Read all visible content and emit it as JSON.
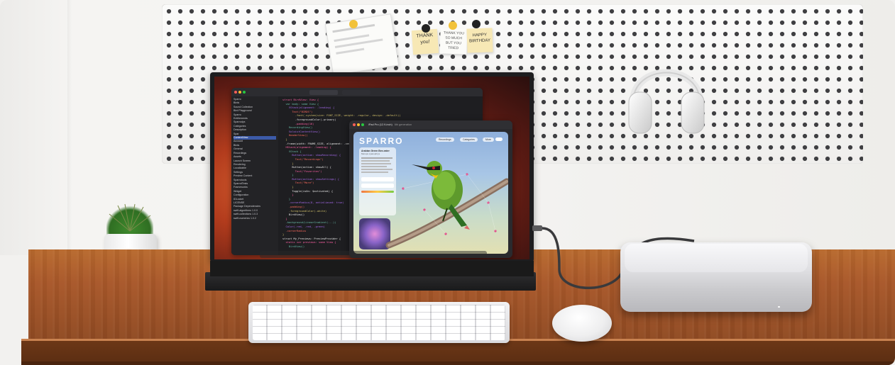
{
  "scene": {
    "description_hidden": true
  },
  "notes": {
    "note1": "THANK you!",
    "note2": "THANK YOU SO MUCH BUT YOU TRIED",
    "note3": "HAPPY BIRTHDAY"
  },
  "monitor": {
    "sidebar_items": [
      "Sparro",
      "Birds",
      "Sound Collection",
      "Bird Playground",
      "Sparro",
      "Entitlements",
      "Sparrodys",
      "Categories",
      "Description",
      "Spar",
      "ContentView",
      "Account",
      "Birds",
      "General",
      "Recordings",
      "Assets",
      "Launch Screen",
      "Rendering",
      "Localizable",
      "Settings",
      "Preview Content",
      "Sparrotools",
      "SparrotTests",
      "Frameworks",
      "Widget",
      "Configuration",
      "IDLocket",
      "LICENSE",
      "Package Dependencies",
      "swift-algorithms 1.0.0",
      "swift-collections 1.0.3",
      "swift-numerics 1.0.2"
    ],
    "code_lines": [
      "struct BirdView: View {",
      "  var body: some View {",
      "    VStack(alignment: .leading) {",
      "      Text(\"BIRDS\")",
      "        .font(.system(size: FONT_SIZE, weight: .regular, design: .default))",
      "        .foregroundColor(.primary)",
      "        .padding(16)",
      "    RecordingView()",
      "    SoloistContentView()",
      "    HeaderView()",
      "  }",
      "  .frame(width: FRAME_SIZE, alignment: .center)",
      "  HStack(alignment: .leading) {",
      "    VStack {",
      "      Button(action: showRecording) {",
      "        Text(\"Recordings\")",
      "      }",
      "      Button(action: showAll) {",
      "        Text(\"Favorites\")",
      "      }",
      "      Button(action: showSettings) {",
      "        Text(\"More\")",
      "      }",
      "      Toggle(isOn: $activated) {",
      "      }",
      "    }",
      "    .cornerRadius(8, antialiased: true)",
      "    .padding()",
      "    .foregroundColor(.white)",
      "    BirdView()",
      "  }",
      "  .background(LinearGradient(...))",
      "  Color(.red, .red, .green)",
      "  .cornerRadius",
      "}",
      "struct My_Previews: PreviewProvider {",
      "  static var previews: some View {",
      "    BirdView()"
    ]
  },
  "ipad": {
    "window_title": "iPad Pro (12.9-inch)",
    "window_subtitle": "6th generation",
    "app_name": "SPARRO",
    "pill1": "Recordings",
    "pill2": "Categories",
    "pill3": "More",
    "card_title": "Arabian Green Bee-eater",
    "card_subtitle": "Merops cyanophrys"
  }
}
